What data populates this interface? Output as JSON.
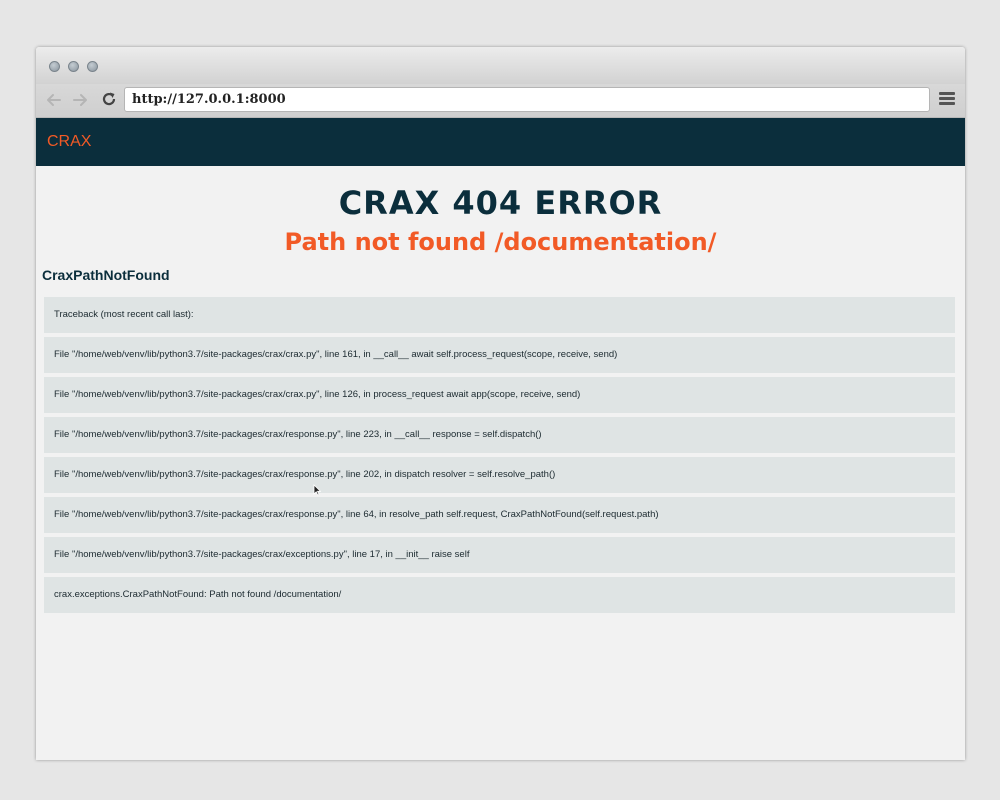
{
  "browser": {
    "url": "http://127.0.0.1:8000",
    "back_icon": "arrow-left-icon",
    "forward_icon": "arrow-right-icon",
    "reload_icon": "reload-icon",
    "menu_icon": "hamburger-menu-icon"
  },
  "navbar": {
    "brand": "CRAX",
    "background_color": "#0b2e3c",
    "accent_color": "#f25a26"
  },
  "error": {
    "title": "CRAX 404 ERROR",
    "subtitle": "Path not found /documentation/",
    "exception_name": "CraxPathNotFound",
    "traceback": [
      "Traceback (most recent call last):",
      "File \"/home/web/venv/lib/python3.7/site-packages/crax/crax.py\", line 161, in __call__ await self.process_request(scope, receive, send)",
      "File \"/home/web/venv/lib/python3.7/site-packages/crax/crax.py\", line 126, in process_request await app(scope, receive, send)",
      "File \"/home/web/venv/lib/python3.7/site-packages/crax/response.py\", line 223, in __call__ response = self.dispatch()",
      "File \"/home/web/venv/lib/python3.7/site-packages/crax/response.py\", line 202, in dispatch resolver = self.resolve_path()",
      "File \"/home/web/venv/lib/python3.7/site-packages/crax/response.py\", line 64, in resolve_path self.request, CraxPathNotFound(self.request.path)",
      "File \"/home/web/venv/lib/python3.7/site-packages/crax/exceptions.py\", line 17, in __init__ raise self",
      "crax.exceptions.CraxPathNotFound: Path not found /documentation/"
    ]
  }
}
